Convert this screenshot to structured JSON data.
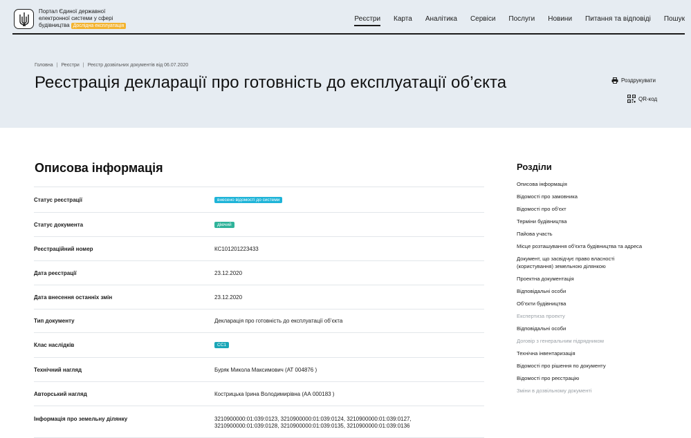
{
  "header": {
    "brand_line1": "Портал Єдиної державної",
    "brand_line2": "електронної системи у сфері",
    "brand_line3": "будівництва",
    "badge": "Дослідна експлуатація",
    "nav": [
      {
        "label": "Реєстри",
        "active": true
      },
      {
        "label": "Карта",
        "active": false
      },
      {
        "label": "Аналітика",
        "active": false
      },
      {
        "label": "Сервіси",
        "active": false
      },
      {
        "label": "Послуги",
        "active": false
      },
      {
        "label": "Новини",
        "active": false
      },
      {
        "label": "Питання та відповіді",
        "active": false
      },
      {
        "label": "Пошук",
        "active": false
      }
    ]
  },
  "breadcrumb": [
    "Головна",
    "Реєстри",
    "Реєстр дозвільних документів від 06.07.2020"
  ],
  "page_title": "Реєстрація декларації про готовність до експлуатації об’єкта",
  "actions": {
    "print": "Роздрукувати",
    "qr": "QR-код"
  },
  "section_title": "Описова інформація",
  "colors": {
    "tag_cyan": "#1fb4d8",
    "tag_green": "#2fb39a",
    "tag_teal": "#1aa6b7",
    "beta": "#f3b32f",
    "hero_bg": "#e6ecf2"
  },
  "rows": [
    {
      "label": "Статус реєстрації",
      "value": "внесено відомості до системи",
      "tag": "cyan"
    },
    {
      "label": "Статус документа",
      "value": "діючий",
      "tag": "green"
    },
    {
      "label": "Реєстраційний номер",
      "value": "КС101201223433"
    },
    {
      "label": "Дата реєстрації",
      "value": "23.12.2020"
    },
    {
      "label": "Дата внесення останніх змін",
      "value": "23.12.2020"
    },
    {
      "label": "Тип документу",
      "value": "Декларація про готовність до експлуатації об’єкта"
    },
    {
      "label": "Клас наслідків",
      "value": "СС1",
      "tag": "teal"
    },
    {
      "label": "Технічний нагляд",
      "value": "Буряк Микола Максимович (АТ 004876 )"
    },
    {
      "label": "Авторський нагляд",
      "value": "Кострицька Ірина Володимирівна (АА 000183 )"
    },
    {
      "label": "Інформація про земельну ділянку",
      "value": "3210900000:01:039:0123, 3210900000:01:039:0124, 3210900000:01:039:0127,",
      "value2": "3210900000:01:039:0128, 3210900000:01:039:0135, 3210900000:01:039:0136"
    }
  ],
  "toc_title": "Розділи",
  "toc": [
    {
      "label": "Описова інформація",
      "muted": false
    },
    {
      "label": "Відомості про замовника",
      "muted": false
    },
    {
      "label": "Відомості про об’єкт",
      "muted": false
    },
    {
      "label": "Терміни будівництва",
      "muted": false
    },
    {
      "label": "Пайова участь",
      "muted": false
    },
    {
      "label": "Місце розташування об’єкта будівництва та адреса",
      "muted": false
    },
    {
      "label": "Документ, що засвідчує право власності (користування) земельною ділянкою",
      "muted": false
    },
    {
      "label": "Проектна документація",
      "muted": false
    },
    {
      "label": "Відповідальні особи",
      "muted": false
    },
    {
      "label": "Об’єкти будівництва",
      "muted": false
    },
    {
      "label": "Експертиза проекту",
      "muted": true
    },
    {
      "label": "Відповідальні особи",
      "muted": false
    },
    {
      "label": "Договір з генеральним підрядником",
      "muted": true
    },
    {
      "label": "Технічна інвентаризація",
      "muted": false
    },
    {
      "label": "Відомості про рішення по документу",
      "muted": false
    },
    {
      "label": "Відомості про реєстрацію",
      "muted": false
    },
    {
      "label": "Зміни в дозвільному документі",
      "muted": true
    }
  ]
}
